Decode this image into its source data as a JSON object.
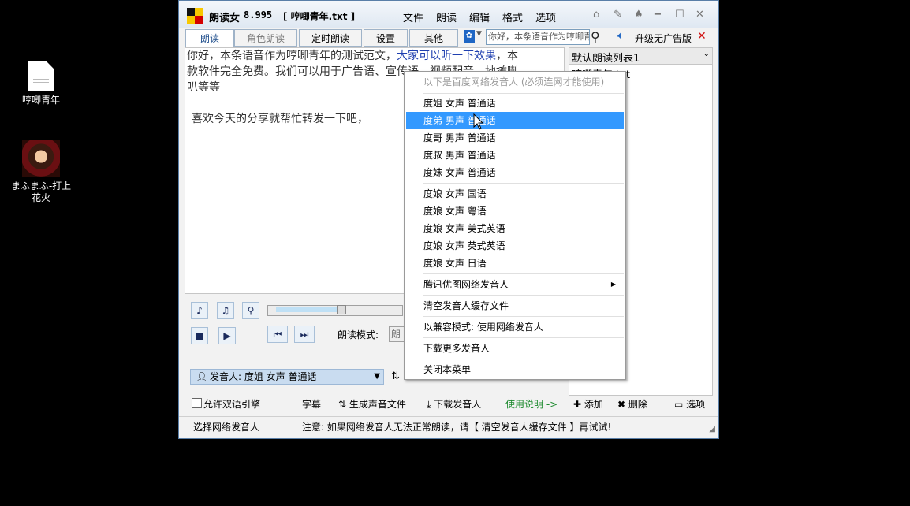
{
  "desktop": {
    "icons": [
      {
        "label": "哼唧青年",
        "icon": "text-file-icon"
      },
      {
        "label": "まふまふ-打上花火",
        "icon": "avatar-image-icon"
      }
    ]
  },
  "window": {
    "app_name": "朗读女",
    "version": "8.995",
    "file": "[ 哼唧青年.txt ]",
    "menu": [
      "文件",
      "朗读",
      "编辑",
      "格式",
      "选项"
    ],
    "tabs": [
      "朗读",
      "角色朗读",
      "定时朗读",
      "设置",
      "其他"
    ],
    "search_placeholder": "你好，本条语音作为哼唧青年的测试范文",
    "upgrade_label": "升级无广告版",
    "editor": {
      "line1a": "你好，本条语音作为哼唧青年的测试范文，",
      "line1b": "大家可以听一下效果",
      "line1c": "，本",
      "line2": "款软件完全免费。我们可以用于广告语、宣传语、视频配音、地摊喇",
      "line3": "叭等等",
      "line4": "喜欢今天的分享就帮忙转发一下吧，"
    },
    "playlist": {
      "selected": "默认朗读列表1",
      "items": [
        "哼唧青年.txt"
      ]
    },
    "controls": {
      "mode_label": "朗读模式:",
      "mode_value": "朗",
      "voice_label": "发音人: 度姐 女声 普通话"
    },
    "bottom": {
      "dual_engine": "允许双语引擎",
      "subtitle": "字幕",
      "generate": "生成声音文件",
      "download": "下载发音人",
      "help": "使用说明 ->",
      "add": "添加",
      "delete": "删除",
      "options": "选项"
    },
    "status": {
      "left": "选择网络发音人",
      "notice": "注意: 如果网络发音人无法正常朗读，请【 清空发音人缓存文件 】再试试!"
    }
  },
  "context_menu": {
    "header": "以下是百度网络发音人 (必须连网才能使用)",
    "group1": [
      "度姐 女声 普通话",
      "度弟 男声 普通话",
      "度哥 男声 普通话",
      "度叔 男声 普通话",
      "度妹 女声 普通话"
    ],
    "group2": [
      "度娘 女声 国语",
      "度娘 女声 粤语",
      "度娘 女声 美式英语",
      "度娘 女声 英式英语",
      "度娘 女声 日语"
    ],
    "tencent": "腾讯优图网络发音人",
    "clear_cache": "清空发音人缓存文件",
    "compat": "以兼容模式: 使用网络发音人",
    "download_more": "下载更多发音人",
    "close": "关闭本菜单"
  },
  "colors": {
    "highlight": "#3399ff",
    "accent_text": "#1f3fb0",
    "help_link": "#1d8a2e"
  }
}
